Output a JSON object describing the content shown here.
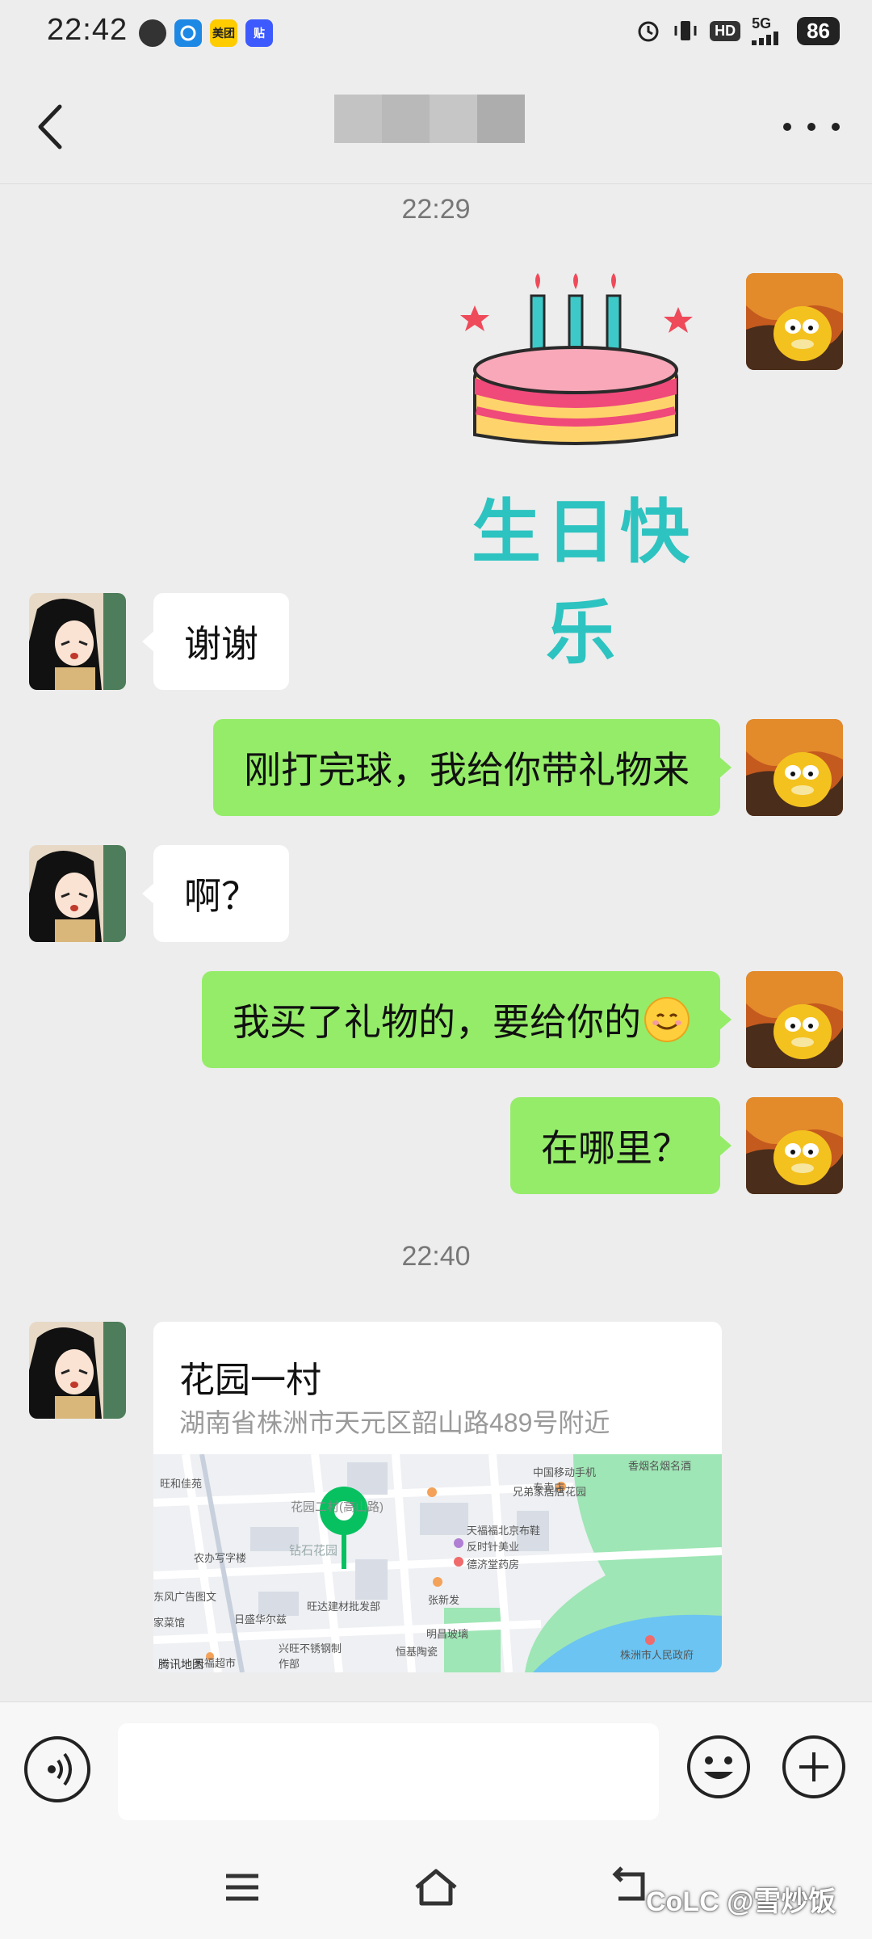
{
  "status_bar": {
    "time": "22:42",
    "app_icons": [
      {
        "icon": "message-bubble-icon",
        "color": "#333333",
        "text": ""
      },
      {
        "icon": "alipay-like-icon",
        "color": "#1e88e5",
        "text": ""
      },
      {
        "icon": "meituan-icon",
        "color": "#ffcc00",
        "text": "美团"
      },
      {
        "icon": "tieba-icon",
        "color": "#3d5afe",
        "text": "贴"
      }
    ],
    "hd_label": "HD",
    "network_label": "5G",
    "battery": "86"
  },
  "header": {
    "title_blurred": true,
    "back_icon": "chevron-left-icon",
    "more_icon": "ellipsis-icon"
  },
  "chat": {
    "timestamp_1": "22:29",
    "sticker_text": "生日快乐",
    "messages": [
      {
        "side": "left",
        "text": "谢谢"
      },
      {
        "side": "right",
        "text": "刚打完球，我给你带礼物来"
      },
      {
        "side": "left",
        "text": "啊？"
      },
      {
        "side": "right",
        "text": "我买了礼物的，要给你的",
        "emoji": "smiling-face-icon"
      },
      {
        "side": "right",
        "text": "在哪里？"
      }
    ],
    "timestamp_2": "22:40",
    "location": {
      "title": "花园一村",
      "address": "湖南省株洲市天元区韶山路489号附近",
      "map_labels": [
        "钻石花园",
        "花园二村(高山路)",
        "兄弟家居店花园",
        "中国移动手机专卖店",
        "香烟名烟名酒",
        "旺和佳苑",
        "东风广告图文",
        "农办写字楼",
        "家菜馆",
        "日盛华尔兹",
        "旺达建材批发部",
        "兴旺不锈钢制作部",
        "恒基陶瓷",
        "明昌玻璃",
        "天福福北京布鞋",
        "反时针美业",
        "德济堂药房",
        "张新发",
        "天福超市",
        "株洲市人民政府",
        "腾讯地图"
      ],
      "map_source": "腾讯地图"
    }
  },
  "input_bar": {
    "placeholder": "",
    "voice_icon": "voice-icon",
    "emoji_icon": "emoji-icon",
    "plus_icon": "plus-icon"
  },
  "nav_bar": {
    "watermark": "CoLC @雪炒饭"
  },
  "colors": {
    "bubble_right": "#95ec69",
    "bubble_left": "#ffffff",
    "background": "#ededed",
    "map_pin": "#07c160"
  }
}
